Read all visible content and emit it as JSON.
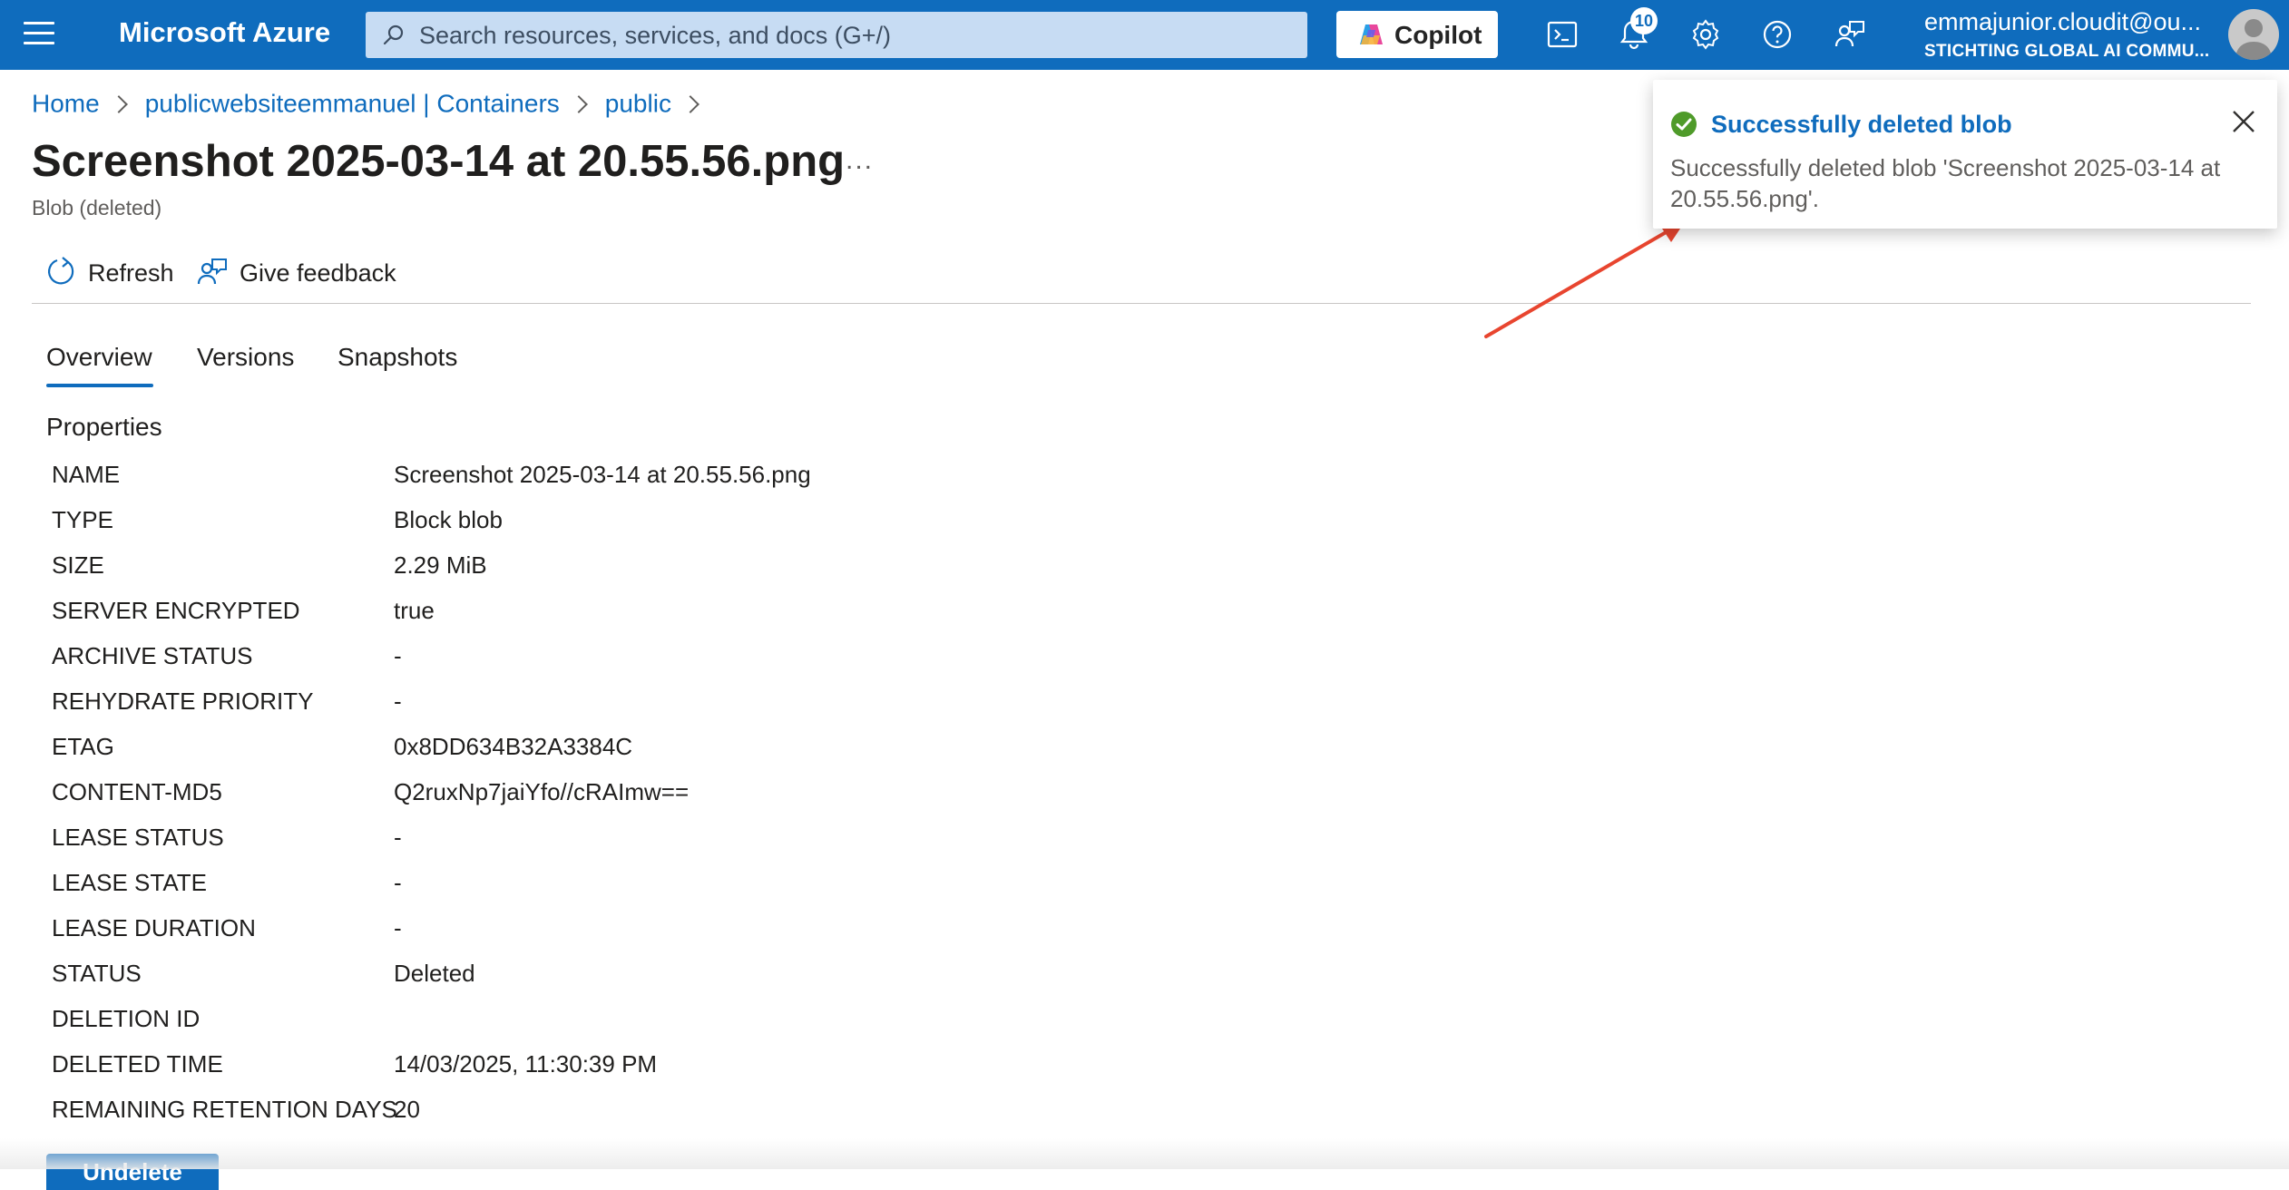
{
  "topbar": {
    "brand": "Microsoft Azure",
    "search_placeholder": "Search resources, services, and docs (G+/)",
    "copilot_label": "Copilot",
    "notification_count": "10",
    "user_name": "emmajunior.cloudit@ou...",
    "user_directory": "STICHTING GLOBAL AI COMMU..."
  },
  "breadcrumb": {
    "items": [
      "Home",
      "publicwebsiteemmanuel | Containers",
      "public"
    ]
  },
  "page": {
    "title": "Screenshot 2025-03-14 at 20.55.56.png",
    "more_label": "...",
    "subtitle": "Blob (deleted)"
  },
  "commands": {
    "refresh_label": "Refresh",
    "feedback_label": "Give feedback"
  },
  "tabs": [
    "Overview",
    "Versions",
    "Snapshots"
  ],
  "properties": {
    "title": "Properties",
    "rows": [
      {
        "key": "NAME",
        "value": "Screenshot 2025-03-14 at 20.55.56.png"
      },
      {
        "key": "TYPE",
        "value": "Block blob"
      },
      {
        "key": "SIZE",
        "value": "2.29 MiB"
      },
      {
        "key": "SERVER ENCRYPTED",
        "value": "true"
      },
      {
        "key": "ARCHIVE STATUS",
        "value": "-"
      },
      {
        "key": "REHYDRATE PRIORITY",
        "value": "-"
      },
      {
        "key": "ETAG",
        "value": "0x8DD634B32A3384C"
      },
      {
        "key": "CONTENT-MD5",
        "value": "Q2ruxNp7jaiYfo//cRAImw=="
      },
      {
        "key": "LEASE STATUS",
        "value": "-"
      },
      {
        "key": "LEASE STATE",
        "value": "-"
      },
      {
        "key": "LEASE DURATION",
        "value": "-"
      },
      {
        "key": "STATUS",
        "value": "Deleted"
      },
      {
        "key": "DELETION ID",
        "value": ""
      },
      {
        "key": "DELETED TIME",
        "value": "14/03/2025, 11:30:39 PM"
      },
      {
        "key": "REMAINING RETENTION DAYS",
        "value": "20"
      }
    ]
  },
  "undelete_label": "Undelete",
  "toast": {
    "title": "Successfully deleted blob",
    "message": "Successfully deleted blob 'Screenshot 2025-03-14 at 20.55.56.png'."
  },
  "colors": {
    "accent": "#0f6cbd",
    "success": "#4f9b2a",
    "annotation_arrow": "#e8452f"
  }
}
